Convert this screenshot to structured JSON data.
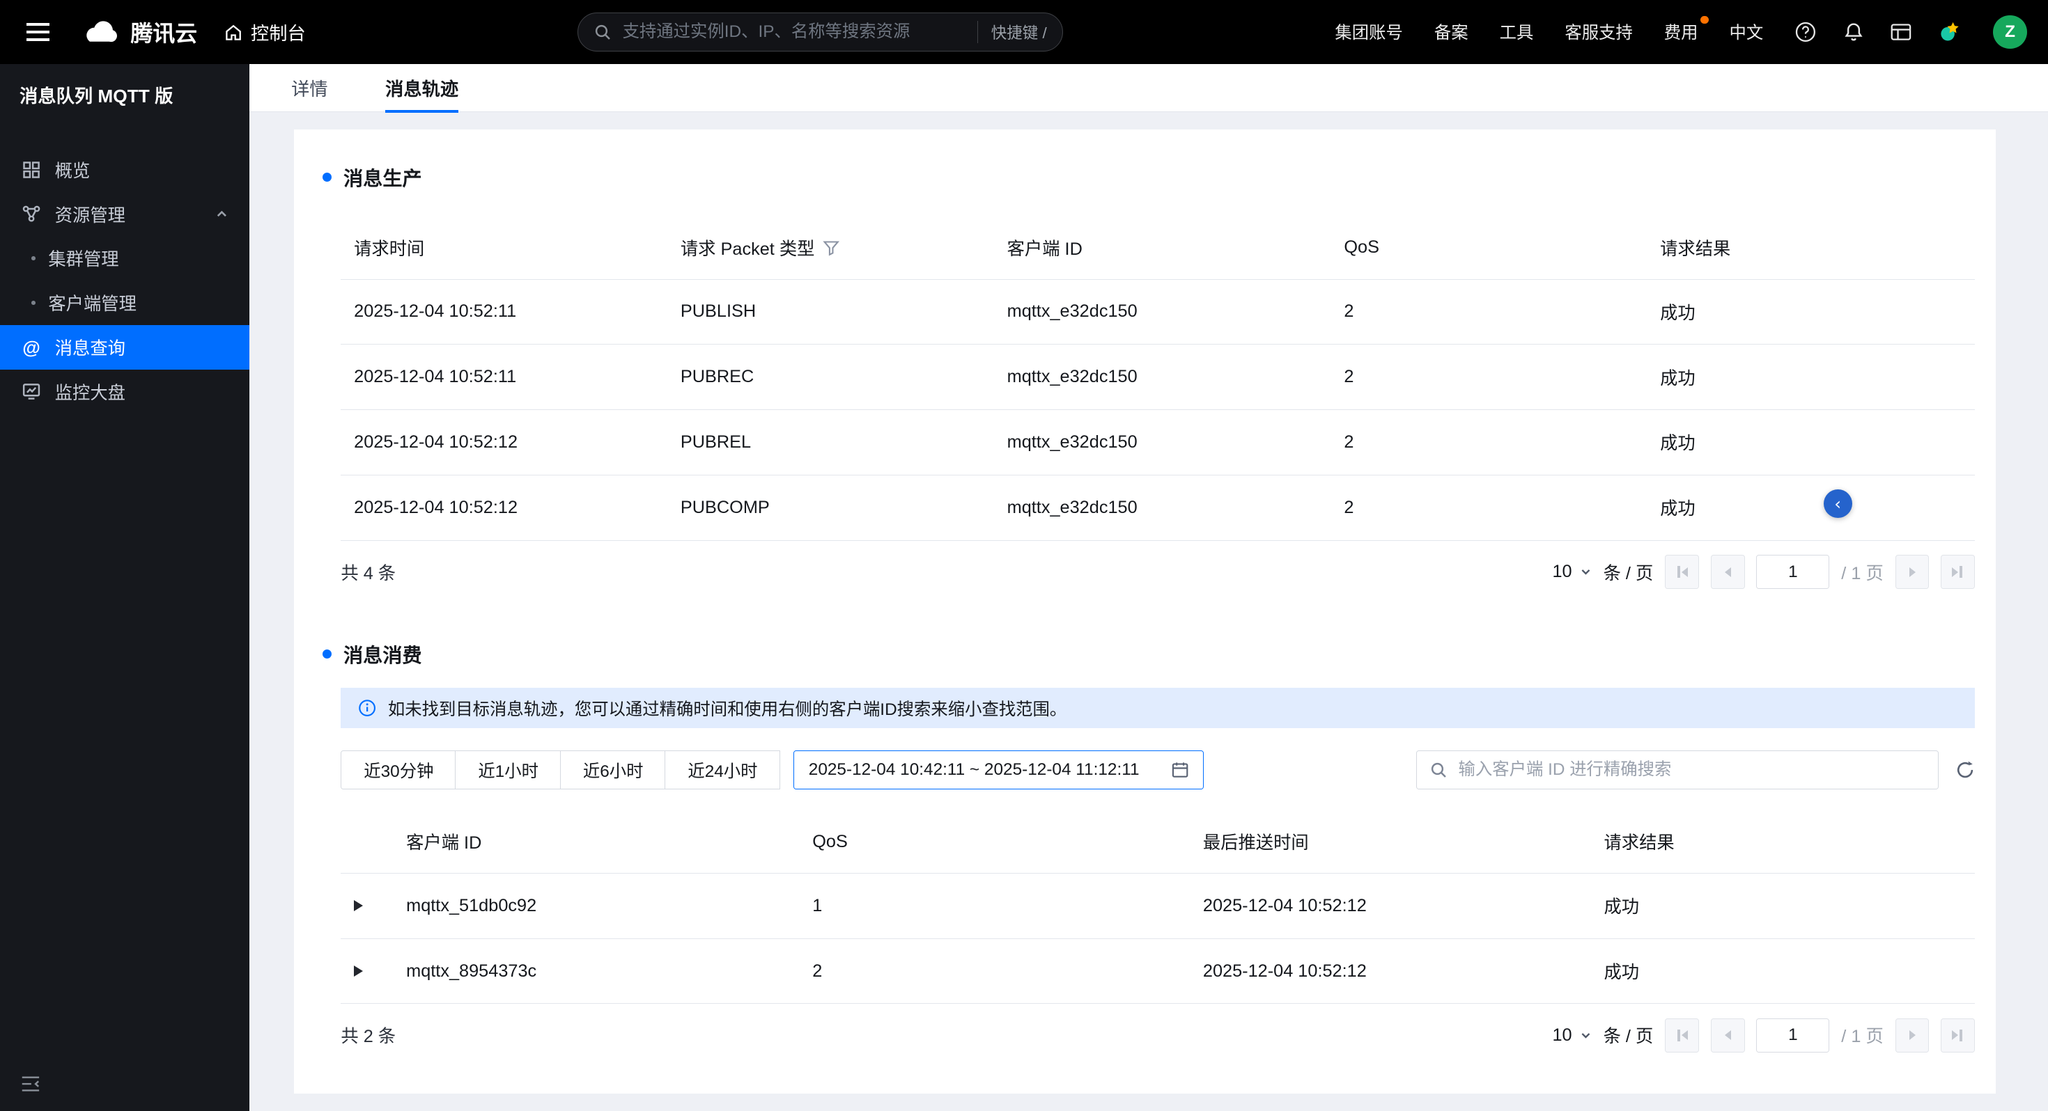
{
  "colors": {
    "accent": "#006eff",
    "success": "#00a870",
    "fee_badge": "#ff7200",
    "selected_nav_bg": "#006eff"
  },
  "topbar": {
    "logo_text": "腾讯云",
    "console_label": "控制台",
    "search_placeholder": "支持通过实例ID、IP、名称等搜索资源",
    "shortcut_label": "快捷键 /",
    "links": [
      "集团账号",
      "备案",
      "工具",
      "客服支持",
      "费用",
      "中文"
    ],
    "avatar_text": "Z"
  },
  "sidebar": {
    "title": "消息队列 MQTT 版",
    "items": [
      {
        "label": "概览"
      },
      {
        "label": "资源管理"
      },
      {
        "label": "集群管理"
      },
      {
        "label": "客户端管理"
      },
      {
        "label": "消息查询"
      },
      {
        "label": "监控大盘"
      }
    ]
  },
  "tabs": [
    {
      "label": "详情"
    },
    {
      "label": "消息轨迹"
    }
  ],
  "production": {
    "title": "消息生产",
    "headers": [
      "请求时间",
      "请求 Packet 类型",
      "客户端 ID",
      "QoS",
      "请求结果"
    ],
    "rows": [
      {
        "time": "2025-12-04 10:52:11",
        "packet": "PUBLISH",
        "client": "mqttx_e32dc150",
        "qos": "2",
        "result": "成功"
      },
      {
        "time": "2025-12-04 10:52:11",
        "packet": "PUBREC",
        "client": "mqttx_e32dc150",
        "qos": "2",
        "result": "成功"
      },
      {
        "time": "2025-12-04 10:52:12",
        "packet": "PUBREL",
        "client": "mqttx_e32dc150",
        "qos": "2",
        "result": "成功"
      },
      {
        "time": "2025-12-04 10:52:12",
        "packet": "PUBCOMP",
        "client": "mqttx_e32dc150",
        "qos": "2",
        "result": "成功"
      }
    ],
    "pagination": {
      "total": "共 4 条",
      "size": "10",
      "unit": "条 / 页",
      "page": "1",
      "of": "/ 1 页"
    }
  },
  "consumption": {
    "title": "消息消费",
    "notice": "如未找到目标消息轨迹，您可以通过精确时间和使用右侧的客户端ID搜索来缩小查找范围。",
    "time_filters": [
      "近30分钟",
      "近1小时",
      "近6小时",
      "近24小时"
    ],
    "date_range": "2025-12-04 10:42:11  ~  2025-12-04 11:12:11",
    "search_placeholder": "输入客户端 ID 进行精确搜索",
    "headers": [
      "客户端 ID",
      "QoS",
      "最后推送时间",
      "请求结果"
    ],
    "rows": [
      {
        "client": "mqttx_51db0c92",
        "qos": "1",
        "time": "2025-12-04 10:52:12",
        "result": "成功"
      },
      {
        "client": "mqttx_8954373c",
        "qos": "2",
        "time": "2025-12-04 10:52:12",
        "result": "成功"
      }
    ],
    "pagination": {
      "total": "共 2 条",
      "size": "10",
      "unit": "条 / 页",
      "page": "1",
      "of": "/ 1 页"
    }
  },
  "drawer_toggle_glyph": "‹"
}
